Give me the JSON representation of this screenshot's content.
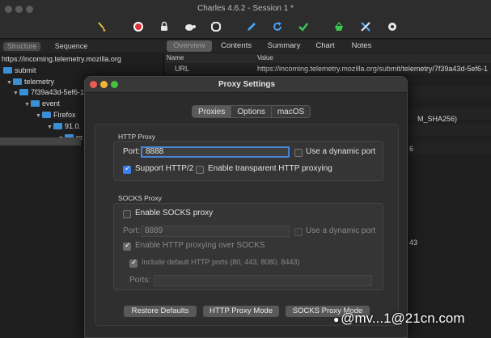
{
  "window": {
    "title": "Charles 4.6.2 - Session 1 *"
  },
  "toolbar": {
    "icons": [
      "broom-icon",
      "record-icon",
      "throttle-icon",
      "turtle-icon",
      "stop-icon",
      "pen-icon",
      "refresh-icon",
      "check-icon",
      "basket-icon",
      "tools-icon",
      "gear-icon"
    ]
  },
  "left_tabs": {
    "structure": "Structure",
    "sequence": "Sequence"
  },
  "right_tabs": {
    "overview": "Overview",
    "contents": "Contents",
    "summary": "Summary",
    "chart": "Chart",
    "notes": "Notes"
  },
  "tree": {
    "rows": [
      {
        "label": "https://incoming.telemetry.mozilla.org"
      },
      {
        "label": "submit"
      },
      {
        "label": "telemetry"
      },
      {
        "label": "7f39a43d-5ef6-1"
      },
      {
        "label": "event"
      },
      {
        "label": "Firefox"
      },
      {
        "label": "91.0."
      },
      {
        "label": "re"
      }
    ]
  },
  "detail": {
    "headers": {
      "name": "Name",
      "value": "Value"
    },
    "rows": [
      {
        "name": "URL",
        "value": "https://incoming.telemetry.mozilla.org/submit/telemetry/7f39a43d-5ef6-1"
      },
      {
        "name": "",
        "value": ""
      },
      {
        "name": "",
        "value": ""
      },
      {
        "name": "",
        "value": ""
      },
      {
        "name": "",
        "value": ""
      },
      {
        "name": "",
        "value": "M_SHA256)"
      },
      {
        "name": "",
        "value": ""
      },
      {
        "name": "",
        "value": ""
      },
      {
        "name": "",
        "value": "6"
      },
      {
        "name": "",
        "value": "43"
      }
    ]
  },
  "dialog": {
    "title": "Proxy Settings",
    "tabs": {
      "proxies": "Proxies",
      "options": "Options",
      "macos": "macOS"
    },
    "http_proxy": {
      "group_label": "HTTP Proxy",
      "port_label": "Port:",
      "port_value": "8888",
      "dynamic_port": {
        "label": "Use a dynamic port",
        "checked": false
      },
      "support_http2": {
        "label": "Support HTTP/2",
        "checked": true
      },
      "transparent": {
        "label": "Enable transparent HTTP proxying",
        "checked": false
      }
    },
    "socks_proxy": {
      "group_label": "SOCKS Proxy",
      "enable": {
        "label": "Enable SOCKS proxy",
        "checked": false
      },
      "port_label": "Port:",
      "port_value": "8889",
      "dynamic_port": {
        "label": "Use a dynamic port",
        "checked": false
      },
      "http_over_socks": {
        "label": "Enable HTTP proxying over SOCKS",
        "checked": true
      },
      "default_ports": {
        "label": "Include default HTTP ports (80, 443, 8080, 8443)",
        "checked": true
      },
      "ports_label": "Ports:",
      "ports_value": ""
    },
    "buttons": {
      "restore": "Restore Defaults",
      "http_mode": "HTTP Proxy Mode",
      "socks_mode": "SOCKS Proxy Mode"
    }
  },
  "watermark": "@mv...1@21cn.com"
}
